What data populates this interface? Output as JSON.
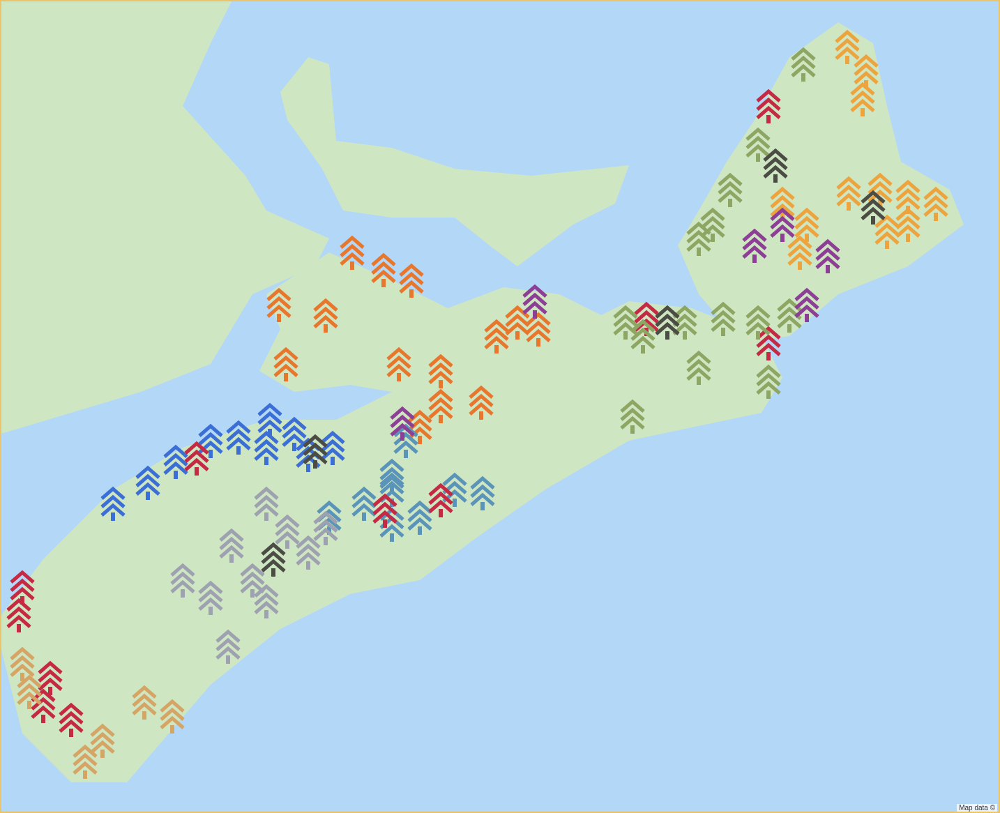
{
  "map": {
    "attribution": "Map data ©",
    "markers": [
      {
        "color": "#e8772e"
      },
      {
        "color": "#e8772e"
      },
      {
        "color": "#e8772e"
      },
      {
        "color": "#e8772e"
      },
      {
        "color": "#e8772e"
      },
      {
        "color": "#e8772e"
      },
      {
        "color": "#e8772e"
      },
      {
        "color": "#e8772e"
      },
      {
        "color": "#e8772e"
      },
      {
        "color": "#e8772e"
      },
      {
        "color": "#e8772e"
      },
      {
        "color": "#e8772e"
      },
      {
        "color": "#e8772e"
      },
      {
        "color": "#e8772e"
      },
      {
        "color": "#3b6fd6"
      },
      {
        "color": "#3b6fd6"
      },
      {
        "color": "#3b6fd6"
      },
      {
        "color": "#3b6fd6"
      },
      {
        "color": "#3b6fd6"
      },
      {
        "color": "#3b6fd6"
      },
      {
        "color": "#3b6fd6"
      },
      {
        "color": "#3b6fd6"
      },
      {
        "color": "#3b6fd6"
      },
      {
        "color": "#3b6fd6"
      },
      {
        "color": "#5b94b9"
      },
      {
        "color": "#5b94b9"
      },
      {
        "color": "#5b94b9"
      },
      {
        "color": "#5b94b9"
      },
      {
        "color": "#5b94b9"
      },
      {
        "color": "#5b94b9"
      },
      {
        "color": "#5b94b9"
      },
      {
        "color": "#5b94b9"
      },
      {
        "color": "#5b94b9"
      },
      {
        "color": "#9ea2b0"
      },
      {
        "color": "#9ea2b0"
      },
      {
        "color": "#9ea2b0"
      },
      {
        "color": "#9ea2b0"
      },
      {
        "color": "#9ea2b0"
      },
      {
        "color": "#9ea2b0"
      },
      {
        "color": "#9ea2b0"
      },
      {
        "color": "#9ea2b0"
      },
      {
        "color": "#9ea2b0"
      },
      {
        "color": "#9ea2b0"
      },
      {
        "color": "#c52a45"
      },
      {
        "color": "#c52a45"
      },
      {
        "color": "#c52a45"
      },
      {
        "color": "#c52a45"
      },
      {
        "color": "#c52a45"
      },
      {
        "color": "#c52a45"
      },
      {
        "color": "#c52a45"
      },
      {
        "color": "#c52a45"
      },
      {
        "color": "#c52a45"
      },
      {
        "color": "#c52a45"
      },
      {
        "color": "#c52a45"
      },
      {
        "color": "#d5a566"
      },
      {
        "color": "#d5a566"
      },
      {
        "color": "#d5a566"
      },
      {
        "color": "#d5a566"
      },
      {
        "color": "#d5a566"
      },
      {
        "color": "#d5a566"
      },
      {
        "color": "#8ea663"
      },
      {
        "color": "#8ea663"
      },
      {
        "color": "#8ea663"
      },
      {
        "color": "#8ea663"
      },
      {
        "color": "#8ea663"
      },
      {
        "color": "#8ea663"
      },
      {
        "color": "#8ea663"
      },
      {
        "color": "#8ea663"
      },
      {
        "color": "#8ea663"
      },
      {
        "color": "#8ea663"
      },
      {
        "color": "#8ea663"
      },
      {
        "color": "#8ea663"
      },
      {
        "color": "#8ea663"
      },
      {
        "color": "#8ea663"
      },
      {
        "color": "#eda43e"
      },
      {
        "color": "#eda43e"
      },
      {
        "color": "#eda43e"
      },
      {
        "color": "#eda43e"
      },
      {
        "color": "#eda43e"
      },
      {
        "color": "#eda43e"
      },
      {
        "color": "#eda43e"
      },
      {
        "color": "#eda43e"
      },
      {
        "color": "#eda43e"
      },
      {
        "color": "#eda43e"
      },
      {
        "color": "#eda43e"
      },
      {
        "color": "#eda43e"
      },
      {
        "color": "#8c3f95"
      },
      {
        "color": "#8c3f95"
      },
      {
        "color": "#8c3f95"
      },
      {
        "color": "#8c3f95"
      },
      {
        "color": "#8c3f95"
      },
      {
        "color": "#8c3f95"
      },
      {
        "color": "#4b4c44"
      },
      {
        "color": "#4b4c44"
      },
      {
        "color": "#4b4c44"
      },
      {
        "color": "#4b4c44"
      },
      {
        "color": "#4b4c44"
      }
    ]
  }
}
